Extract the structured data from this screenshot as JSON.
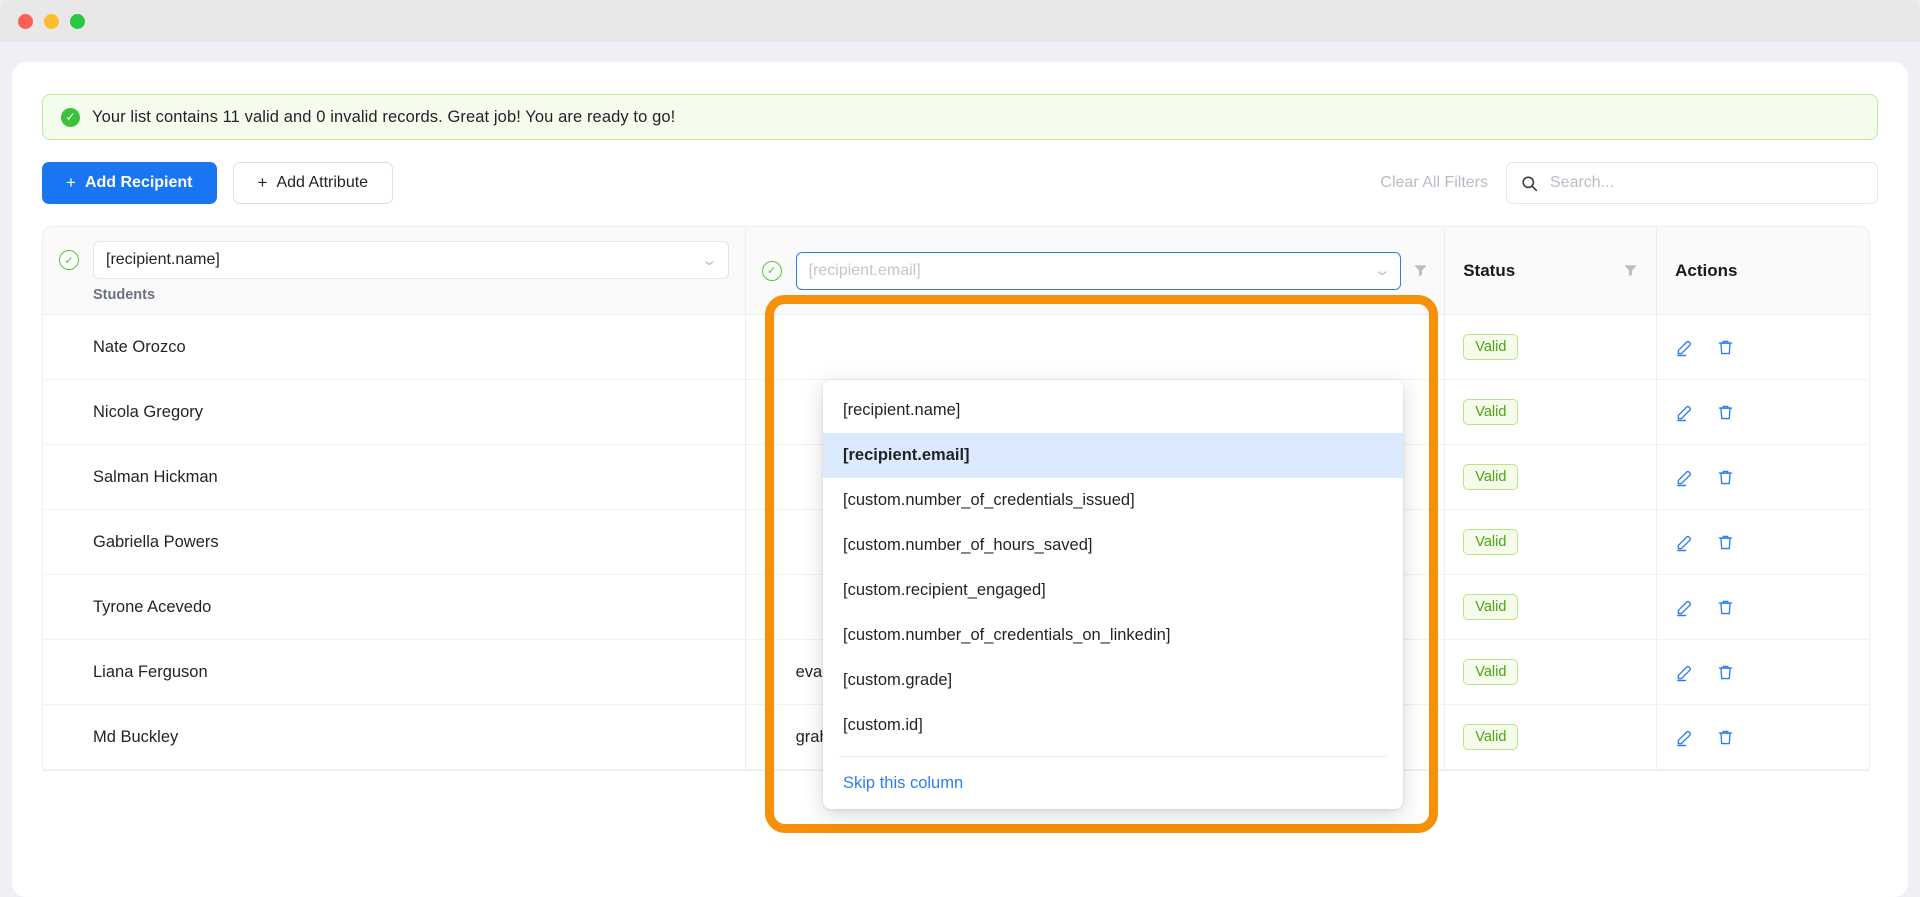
{
  "window": {
    "traffic_lights": [
      "close",
      "minimize",
      "maximize"
    ]
  },
  "banner": {
    "icon": "check-circle-icon",
    "text": "Your list contains 11 valid and 0 invalid records. Great job! You are ready to go!"
  },
  "toolbar": {
    "add_recipient_label": "Add Recipient",
    "add_attribute_label": "Add Attribute",
    "plus": "+",
    "clear_all_filters_label": "Clear All Filters",
    "search_placeholder": "Search...",
    "search_value": ""
  },
  "table": {
    "columns": {
      "name": {
        "mapping_value": "[recipient.name]",
        "subtitle": "Students",
        "valid_icon": "check-circle-outline-icon",
        "chevron": "chevron-down-icon"
      },
      "email": {
        "mapping_placeholder": "[recipient.email]",
        "mapping_value": "",
        "valid_icon": "check-circle-outline-icon",
        "chevron": "chevron-down-icon",
        "filter_icon": "funnel-icon"
      },
      "status": {
        "label": "Status",
        "filter_icon": "funnel-icon"
      },
      "actions": {
        "label": "Actions"
      }
    },
    "rows": [
      {
        "name": "Nate Orozco",
        "email": "",
        "status": "Valid",
        "edit_icon": "pencil-icon",
        "delete_icon": "trash-icon"
      },
      {
        "name": "Nicola Gregory",
        "email": "",
        "status": "Valid",
        "edit_icon": "pencil-icon",
        "delete_icon": "trash-icon"
      },
      {
        "name": "Salman Hickman",
        "email": "",
        "status": "Valid",
        "edit_icon": "pencil-icon",
        "delete_icon": "trash-icon"
      },
      {
        "name": "Gabriella Powers",
        "email": "",
        "status": "Valid",
        "edit_icon": "pencil-icon",
        "delete_icon": "trash-icon"
      },
      {
        "name": "Tyrone Acevedo",
        "email": "",
        "status": "Valid",
        "edit_icon": "pencil-icon",
        "delete_icon": "trash-icon"
      },
      {
        "name": "Liana Ferguson",
        "email": "evans@hotmail.com",
        "status": "Valid",
        "edit_icon": "pencil-icon",
        "delete_icon": "trash-icon"
      },
      {
        "name": "Md Buckley",
        "email": "graham@icloud.com",
        "status": "Valid",
        "edit_icon": "pencil-icon",
        "delete_icon": "trash-icon"
      }
    ]
  },
  "dropdown": {
    "selected": "[recipient.email]",
    "items": [
      "[recipient.name]",
      "[recipient.email]",
      "[custom.number_of_credentials_issued]",
      "[custom.number_of_hours_saved]",
      "[custom.recipient_engaged]",
      "[custom.number_of_credentials_on_linkedin]",
      "[custom.grade]",
      "[custom.id]"
    ],
    "skip_label": "Skip this column"
  },
  "highlight": {
    "color": "#f79009"
  },
  "colors": {
    "primary": "#1876f2",
    "success": "#3cc13b",
    "link": "#2b7df2",
    "highlight": "#f79009"
  }
}
